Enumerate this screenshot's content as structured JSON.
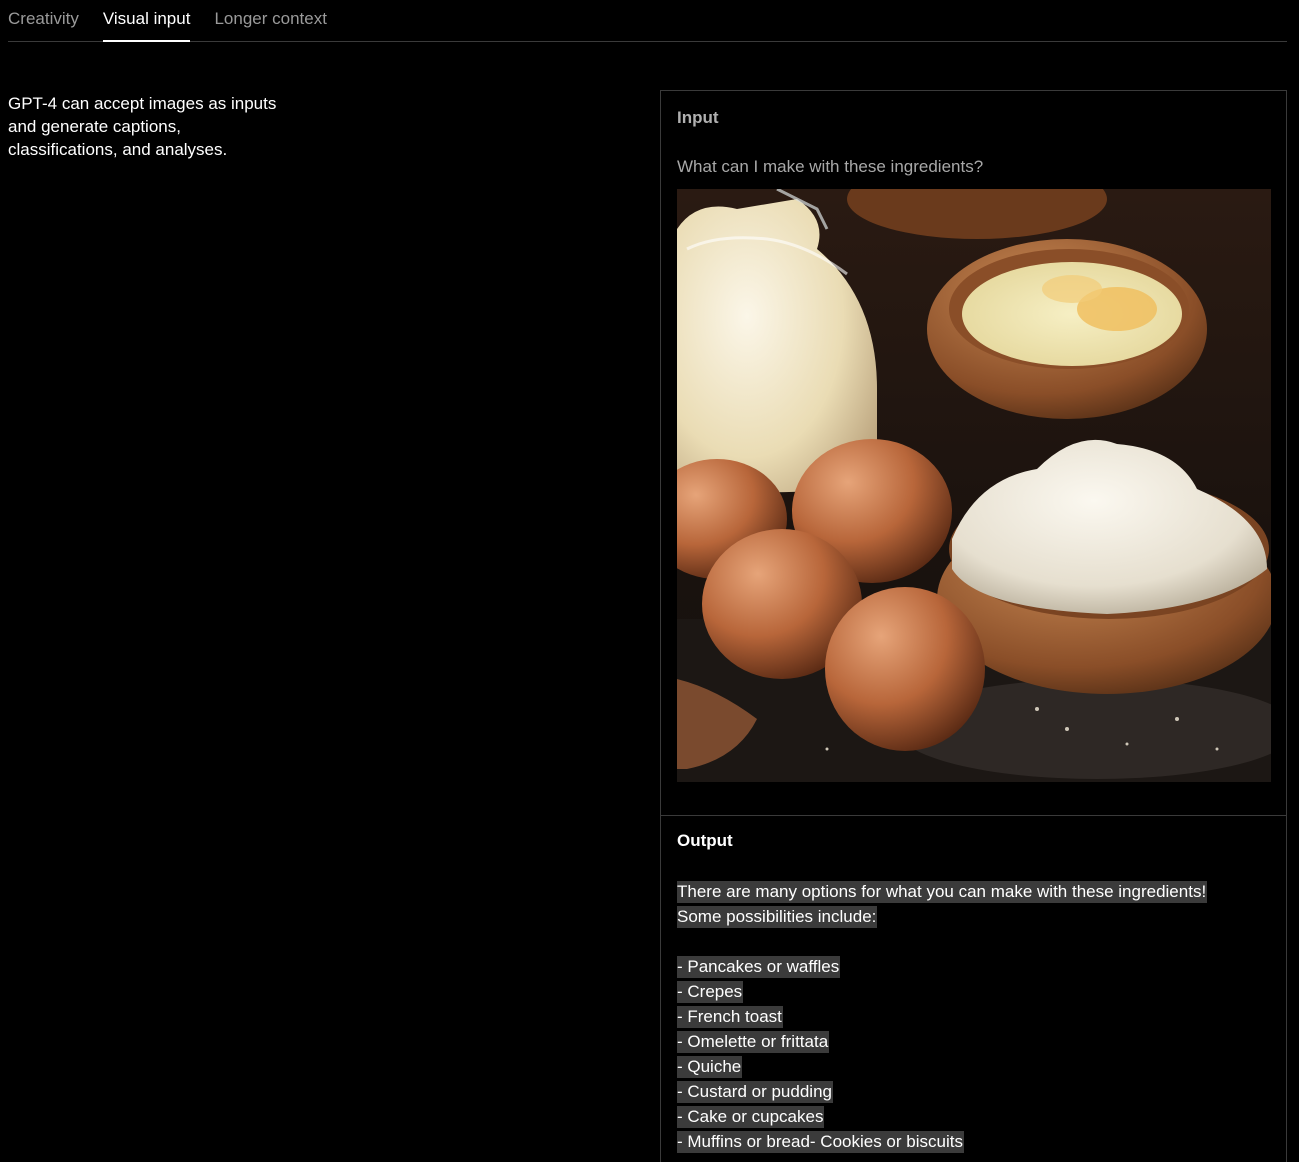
{
  "tabs": [
    {
      "label": "Creativity",
      "active": false
    },
    {
      "label": "Visual input",
      "active": true
    },
    {
      "label": "Longer context",
      "active": false
    }
  ],
  "description": {
    "lines": [
      "GPT-4 can accept images as inputs",
      "and generate captions,",
      "classifications, and analyses."
    ]
  },
  "input": {
    "heading": "Input",
    "prompt": "What can I make with these ingredients?",
    "image_subject": "milk-eggs-flour-photo"
  },
  "output": {
    "heading": "Output",
    "intro_lines": [
      "There are many options for what you can make with these ingredients!",
      "Some possibilities include:"
    ],
    "items": [
      "- Pancakes or waffles",
      "- Crepes",
      "- French toast",
      "- Omelette or frittata",
      "- Quiche",
      "- Custard or pudding",
      "- Cake or cupcakes",
      "- Muffins or bread- Cookies or biscuits"
    ]
  },
  "colors": {
    "background": "#000000",
    "text": "#ffffff",
    "muted_text": "#9a9a9a",
    "border": "#3a3a3a",
    "highlight": "#3b3b3b"
  }
}
